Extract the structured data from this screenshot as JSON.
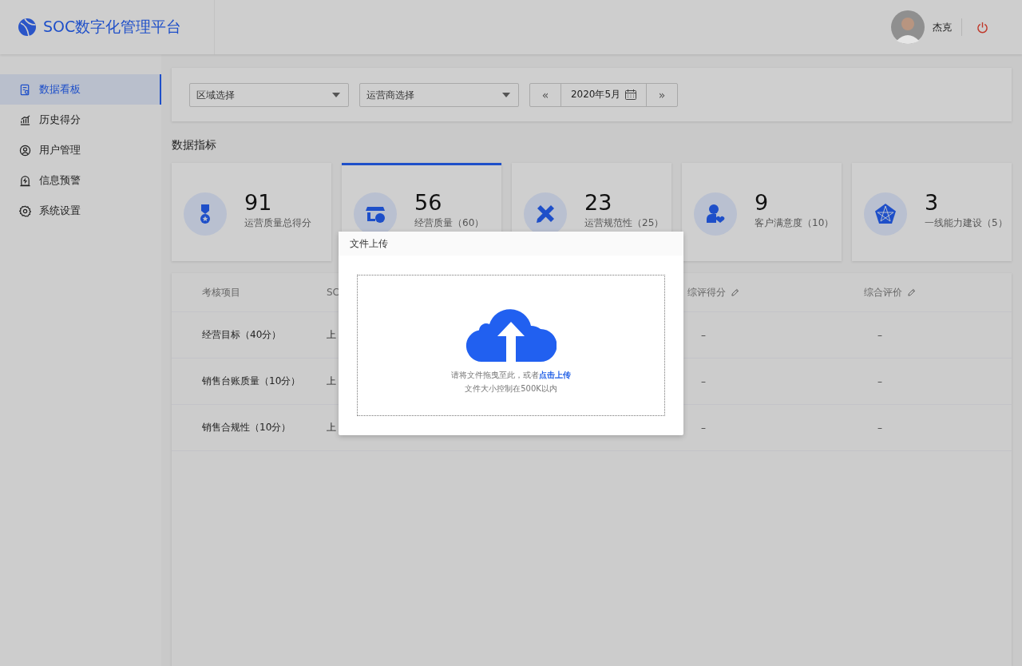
{
  "header": {
    "title": "SOC数字化管理平台",
    "user": "杰克"
  },
  "sidebar": {
    "items": [
      {
        "label": "数据看板",
        "selected": true,
        "kind": "board"
      },
      {
        "label": "历史得分",
        "selected": false,
        "kind": "chart"
      },
      {
        "label": "用户管理",
        "selected": false,
        "kind": "user"
      },
      {
        "label": "信息预警",
        "selected": false,
        "kind": "alert"
      },
      {
        "label": "系统设置",
        "selected": false,
        "kind": "settings"
      }
    ]
  },
  "filters": {
    "region": {
      "placeholder": "区域选择"
    },
    "operator": {
      "placeholder": "运营商选择"
    },
    "date": {
      "prev": "«",
      "value": "2020年5月",
      "next": "»"
    }
  },
  "section_title": "数据指标",
  "metrics": [
    {
      "value": "91",
      "label": "运营质量总得分",
      "selected": false,
      "kind": "medal"
    },
    {
      "value": "56",
      "label": "经营质量（60）",
      "selected": true,
      "kind": "shop"
    },
    {
      "value": "23",
      "label": "运营规范性（25）",
      "selected": false,
      "kind": "tools"
    },
    {
      "value": "9",
      "label": "客户满意度（10）",
      "selected": false,
      "kind": "customer"
    },
    {
      "value": "3",
      "label": "一线能力建设（5）",
      "selected": false,
      "kind": "pentagon"
    }
  ],
  "table": {
    "columns": [
      {
        "label": "考核项目",
        "editable": false
      },
      {
        "label": "SC"
      },
      {
        "label": "综评得分",
        "editable": true
      },
      {
        "label": "综合评价",
        "editable": true
      }
    ],
    "rows": [
      {
        "cells": [
          "经营目标（40分）",
          "上",
          "–",
          "–"
        ]
      },
      {
        "cells": [
          "销售台账质量（10分）",
          "上",
          "–",
          "–"
        ]
      },
      {
        "cells": [
          "销售合规性（10分）",
          "上",
          "–",
          "–"
        ]
      }
    ]
  },
  "dialog": {
    "title": "文件上传",
    "hint": "请将文件拖曳至此，或者",
    "link": "点击上传",
    "limit": "文件大小控制在500K以内"
  }
}
